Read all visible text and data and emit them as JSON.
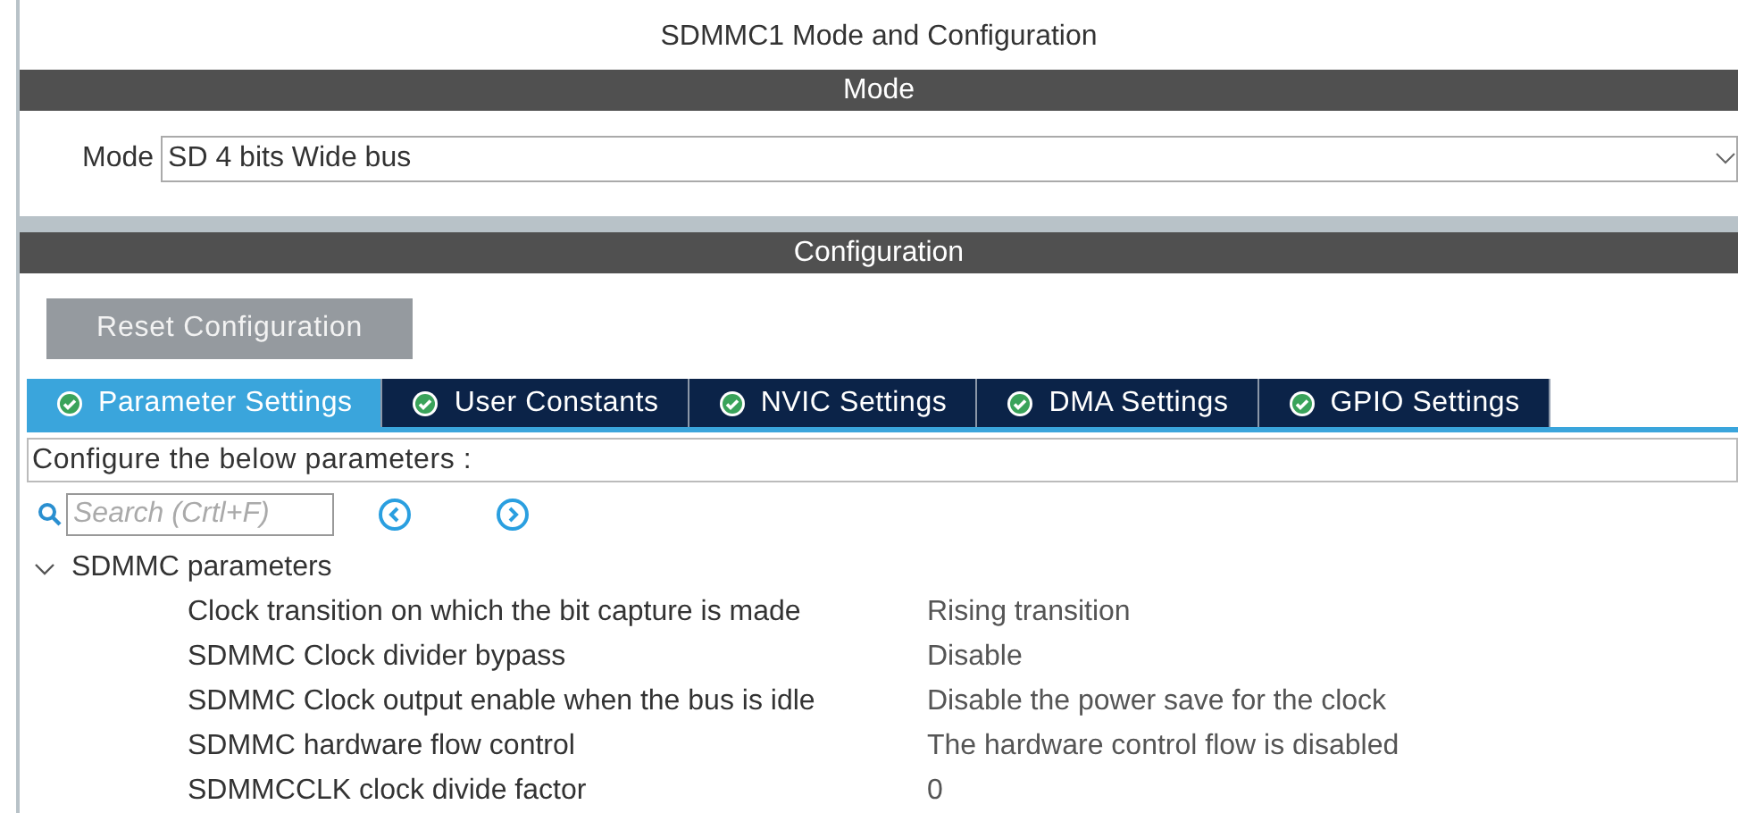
{
  "title": "SDMMC1 Mode and Configuration",
  "mode_section": {
    "header": "Mode",
    "label": "Mode",
    "value": "SD 4 bits Wide bus"
  },
  "configuration_section": {
    "header": "Configuration",
    "reset_button": "Reset Configuration",
    "tabs": [
      {
        "label": "Parameter Settings",
        "selected": true
      },
      {
        "label": "User Constants",
        "selected": false
      },
      {
        "label": "NVIC Settings",
        "selected": false
      },
      {
        "label": "DMA Settings",
        "selected": false
      },
      {
        "label": "GPIO Settings",
        "selected": false
      }
    ],
    "hint": "Configure the below parameters :",
    "search": {
      "placeholder": "Search (Crtl+F)"
    },
    "tree": [
      {
        "label": "SDMMC parameters",
        "expanded": true,
        "children": [
          {
            "name": "Clock transition on which the bit capture is made",
            "value": "Rising transition"
          },
          {
            "name": "SDMMC Clock divider bypass",
            "value": "Disable"
          },
          {
            "name": "SDMMC Clock output enable when the bus is idle",
            "value": "Disable the power save for the clock"
          },
          {
            "name": "SDMMC hardware flow control",
            "value": "The hardware control flow is disabled"
          },
          {
            "name": "SDMMCCLK clock divide factor",
            "value": "0"
          }
        ]
      }
    ]
  }
}
